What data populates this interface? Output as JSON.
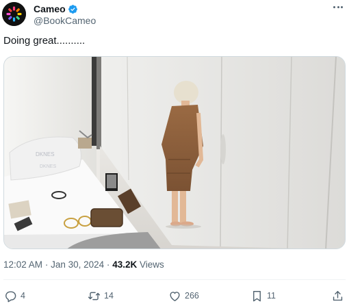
{
  "account": {
    "display_name": "Cameo",
    "handle": "@BookCameo",
    "avatar_icon": "cameo-logo-icon",
    "verified_icon": "verified-badge-icon"
  },
  "tweet": {
    "text": "Doing great..........",
    "time": "12:02 AM",
    "separator": "·",
    "date": "Jan 30, 2024",
    "views_count": "43.2K",
    "views_label": "Views"
  },
  "media": {
    "image_icon": "photo-icon",
    "pillow_text": "DKNES",
    "pillow_text_2": "DKNES"
  },
  "actions": {
    "reply_count": "4",
    "repost_count": "14",
    "like_count": "266",
    "bookmark_count": "11"
  },
  "colors": {
    "text_primary": "#0f1419",
    "text_secondary": "#536471",
    "verified_blue": "#1d9bf0",
    "border": "#cfd9de"
  }
}
